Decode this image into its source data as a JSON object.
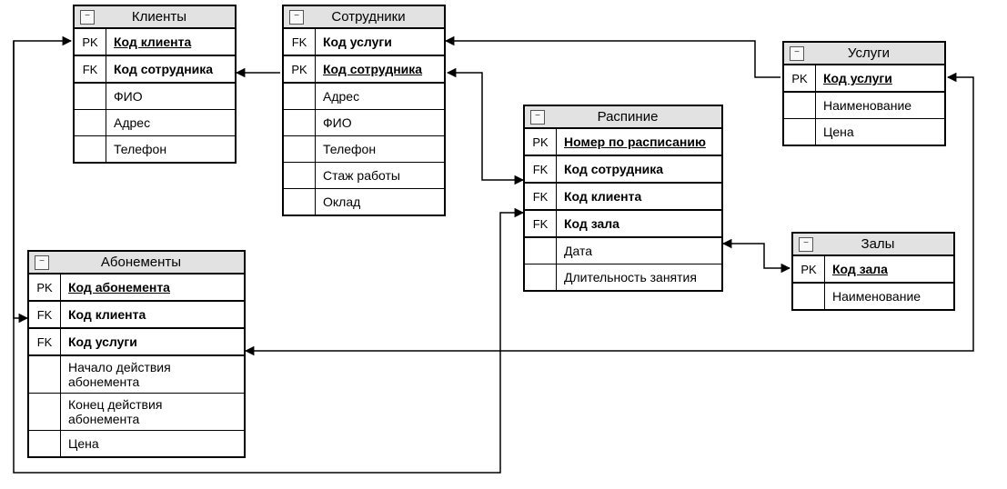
{
  "entities": {
    "clients": {
      "title": "Клиенты",
      "rows": [
        {
          "key": "PK",
          "label": "Код клиента",
          "style": "pk",
          "sectionEnd": true
        },
        {
          "key": "FK",
          "label": "Код сотрудника",
          "style": "fk",
          "sectionEnd": true
        },
        {
          "key": "",
          "label": "ФИО",
          "style": "plain"
        },
        {
          "key": "",
          "label": "Адрес",
          "style": "plain"
        },
        {
          "key": "",
          "label": "Телефон",
          "style": "plain"
        }
      ]
    },
    "employees": {
      "title": "Сотрудники",
      "rows": [
        {
          "key": "FK",
          "label": "Код услуги",
          "style": "fk",
          "sectionEnd": true
        },
        {
          "key": "PK",
          "label": "Код сотрудника",
          "style": "pk",
          "sectionEnd": true
        },
        {
          "key": "",
          "label": "Адрес",
          "style": "plain"
        },
        {
          "key": "",
          "label": "ФИО",
          "style": "plain"
        },
        {
          "key": "",
          "label": "Телефон",
          "style": "plain"
        },
        {
          "key": "",
          "label": "Стаж работы",
          "style": "plain"
        },
        {
          "key": "",
          "label": "Оклад",
          "style": "plain"
        }
      ]
    },
    "services": {
      "title": "Услуги",
      "rows": [
        {
          "key": "PK",
          "label": "Код услуги",
          "style": "pk",
          "sectionEnd": true
        },
        {
          "key": "",
          "label": "Наименование",
          "style": "plain"
        },
        {
          "key": "",
          "label": "Цена",
          "style": "plain"
        }
      ]
    },
    "schedule": {
      "title": "Распиние",
      "rows": [
        {
          "key": "PK",
          "label": "Номер по расписанию",
          "style": "pk",
          "sectionEnd": true
        },
        {
          "key": "FK",
          "label": "Код сотрудника",
          "style": "fk",
          "sectionEnd": true
        },
        {
          "key": "FK",
          "label": "Код клиента",
          "style": "fk",
          "sectionEnd": true
        },
        {
          "key": "FK",
          "label": "Код зала",
          "style": "fk",
          "sectionEnd": true
        },
        {
          "key": "",
          "label": "Дата",
          "style": "plain"
        },
        {
          "key": "",
          "label": "Длительность занятия",
          "style": "plain"
        }
      ]
    },
    "subscriptions": {
      "title": "Абонементы",
      "rows": [
        {
          "key": "PK",
          "label": "Код абонемента",
          "style": "pk",
          "sectionEnd": true
        },
        {
          "key": "FK",
          "label": "Код клиента",
          "style": "fk",
          "sectionEnd": true
        },
        {
          "key": "FK",
          "label": "Код услуги",
          "style": "fk",
          "sectionEnd": true
        },
        {
          "key": "",
          "label": "Начало действия абонемента",
          "style": "plain"
        },
        {
          "key": "",
          "label": "Конец действия абонемента",
          "style": "plain"
        },
        {
          "key": "",
          "label": "Цена",
          "style": "plain"
        }
      ]
    },
    "halls": {
      "title": "Залы",
      "rows": [
        {
          "key": "PK",
          "label": "Код зала",
          "style": "pk",
          "sectionEnd": true
        },
        {
          "key": "",
          "label": "Наименование",
          "style": "plain"
        }
      ]
    }
  }
}
